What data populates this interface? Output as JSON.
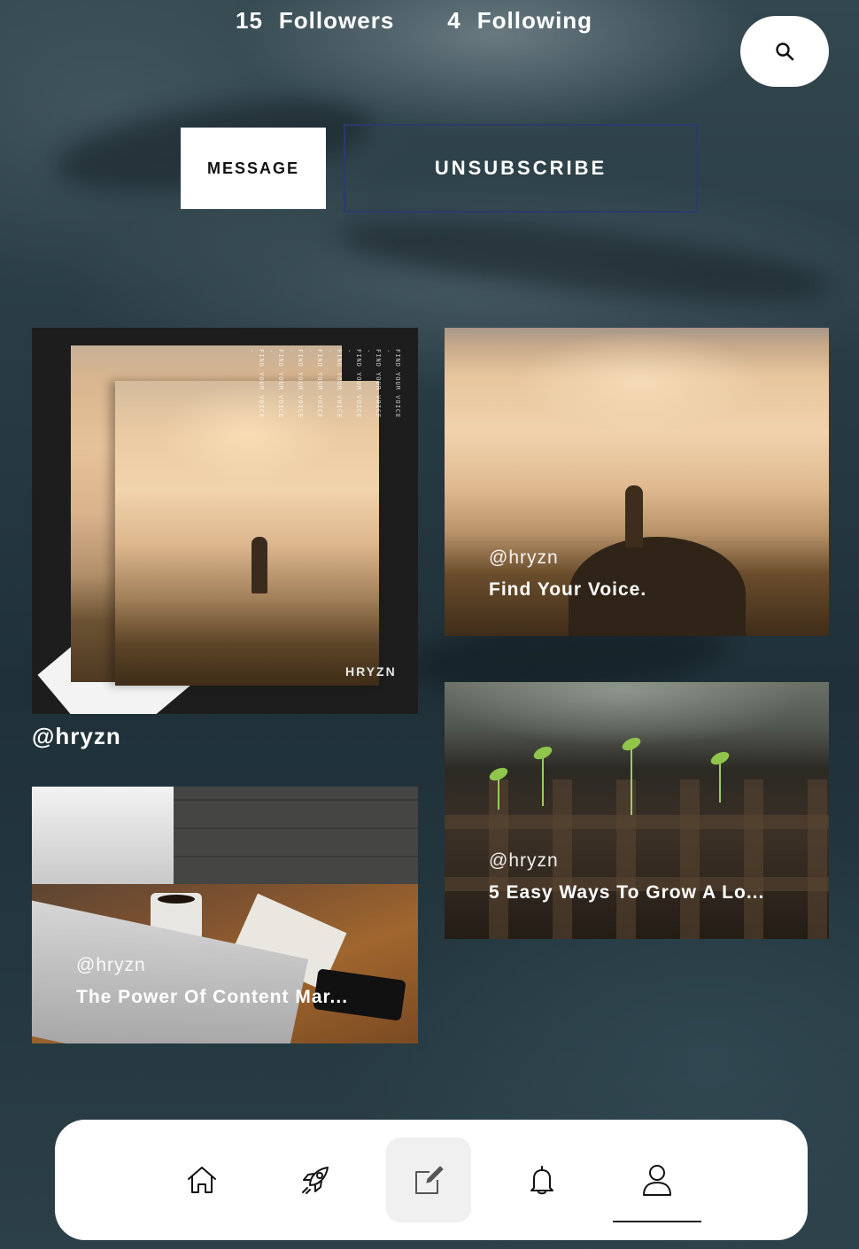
{
  "profile": {
    "followers_count": "15",
    "followers_label": "Followers",
    "following_count": "4",
    "following_label": "Following"
  },
  "actions": {
    "message_label": "MESSAGE",
    "unsubscribe_label": "UNSUBSCRIBE"
  },
  "search": {
    "icon": "search-icon"
  },
  "posts": [
    {
      "handle": "@hryzn",
      "title": "",
      "brand": "HRYZN",
      "artwork_text": "FIND YOUR VOICE ·"
    },
    {
      "handle": "@hryzn",
      "title": "Find Your Voice."
    },
    {
      "handle": "@hryzn",
      "title": "5 Easy Ways To Grow A Lo..."
    },
    {
      "handle": "@hryzn",
      "title": "The Power Of Content Mar..."
    }
  ],
  "nav": {
    "items": [
      {
        "icon": "home-icon",
        "active": false
      },
      {
        "icon": "rocket-icon",
        "active": false
      },
      {
        "icon": "compose-icon",
        "active": true
      },
      {
        "icon": "bell-icon",
        "active": false
      },
      {
        "icon": "user-icon",
        "active": false,
        "underlined": true
      }
    ]
  },
  "colors": {
    "unsubscribe_border": "#2c3a6b",
    "nav_background": "#ffffff",
    "active_tab_background": "#f0f0f0"
  }
}
